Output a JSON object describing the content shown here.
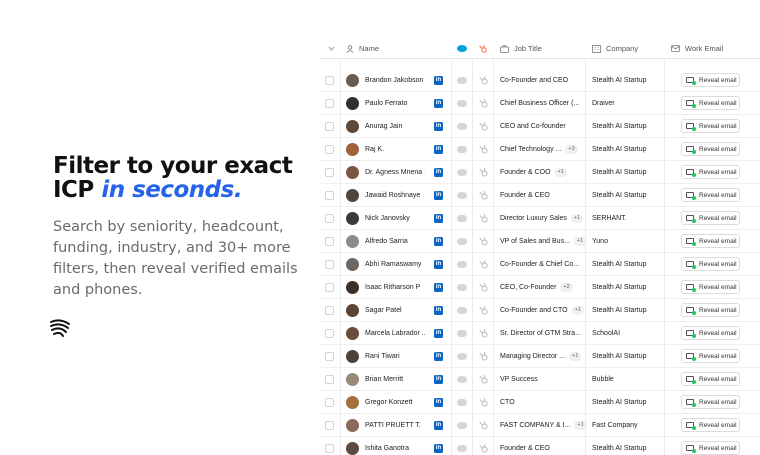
{
  "hero": {
    "title_line1": "Filter to your exact",
    "title_prefix": "ICP ",
    "title_accent": "in seconds.",
    "subtitle": "Search by seniority, headcount, funding, industry, and 30+ more filters, then reveal verified emails and phones."
  },
  "table": {
    "headers": {
      "name": "Name",
      "job_title": "Job Title",
      "company": "Company",
      "work_email": "Work Email"
    },
    "reveal_label": "Reveal email",
    "linkedin_glyph": "in",
    "colors": {
      "linkedin": "#0a66c2",
      "hubspot": "#ff7a59",
      "salesforce": "#00a1e0",
      "accent": "#2563eb"
    },
    "rows": [
      {
        "name": "Brandon Jakobson",
        "job": "Co-Founder and CEO",
        "badge": "",
        "company": "Stealth AI Startup",
        "avatar": "#6b5a4e"
      },
      {
        "name": "Paulo Ferrato",
        "job": "Chief Business Officer (...",
        "badge": "",
        "company": "Draiver",
        "avatar": "#2f2f2f"
      },
      {
        "name": "Anurag Jain",
        "job": "CEO and Co-founder",
        "badge": "",
        "company": "Stealth AI Startup",
        "avatar": "#5e4a3a"
      },
      {
        "name": "Raj K.",
        "job": "Chief Technology ...",
        "badge": "+3",
        "company": "Stealth AI Startup",
        "avatar": "#a0623a"
      },
      {
        "name": "Dr. Agness Mnena ...",
        "job": "Founder & COO",
        "badge": "+1",
        "company": "Stealth AI Startup",
        "avatar": "#7a5544"
      },
      {
        "name": "Jawaid Roshnaye",
        "job": "Founder & CEO",
        "badge": "",
        "company": "Stealth AI Startup",
        "avatar": "#4d4640"
      },
      {
        "name": "Nick Janovsky",
        "job": "Director Luxury Sales",
        "badge": "+1",
        "company": "SERHANT.",
        "avatar": "#3a3a3a"
      },
      {
        "name": "Alfredo Sarria",
        "job": "VP of Sales and Bus...",
        "badge": "+1",
        "company": "Yuno",
        "avatar": "#8c8c8c"
      },
      {
        "name": "Abhi Ramaswamy",
        "job": "Co-Founder & Chief Co...",
        "badge": "",
        "company": "Stealth AI Startup",
        "avatar": "#6e6660"
      },
      {
        "name": "Isaac Ritharson P",
        "job": "CEO, Co-Founder",
        "badge": "+2",
        "company": "Stealth AI Startup",
        "avatar": "#3b2f2a"
      },
      {
        "name": "Sagar Patel",
        "job": "Co-Founder and CTO",
        "badge": "+1",
        "company": "Stealth AI Startup",
        "avatar": "#5a4435"
      },
      {
        "name": "Marcela Labrador ...",
        "job": "Sr. Director of GTM Stra...",
        "badge": "",
        "company": "SchoolAI",
        "avatar": "#6a4b3c"
      },
      {
        "name": "Rani Tiwari",
        "job": "Managing Director ...",
        "badge": "+1",
        "company": "Stealth AI Startup",
        "avatar": "#4f4038"
      },
      {
        "name": "Brian Merritt",
        "job": "VP Success",
        "badge": "",
        "company": "Bubble",
        "avatar": "#9a8a7a"
      },
      {
        "name": "Gregor Konzett",
        "job": "CTO",
        "badge": "",
        "company": "Stealth AI Startup",
        "avatar": "#a6703e"
      },
      {
        "name": "PATTI PRUETT T.",
        "job": "FAST COMPANY & I...",
        "badge": "+1",
        "company": "Fast Company",
        "avatar": "#8a6a5a"
      },
      {
        "name": "Ishita Ganotra",
        "job": "Founder & CEO",
        "badge": "",
        "company": "Stealth AI Startup",
        "avatar": "#5c4a40"
      }
    ]
  }
}
